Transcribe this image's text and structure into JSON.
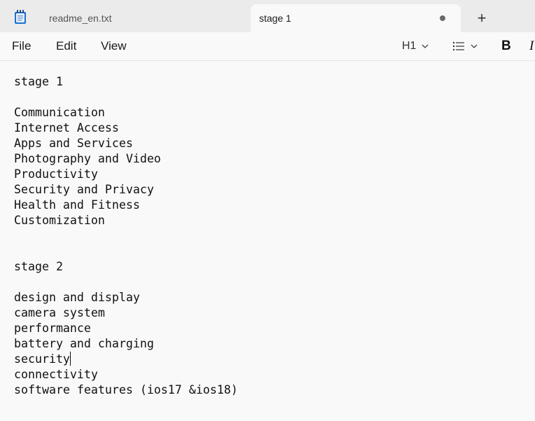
{
  "tabs": [
    {
      "label": "readme_en.txt",
      "active": false
    },
    {
      "label": "stage 1",
      "active": true,
      "unsaved": true
    }
  ],
  "new_tab_label": "+",
  "menu": {
    "file": "File",
    "edit": "Edit",
    "view": "View"
  },
  "toolbar": {
    "heading": "H1",
    "bold": "B",
    "italic": "I"
  },
  "editor": {
    "lines": [
      "stage 1",
      "",
      "Communication",
      "Internet Access",
      "Apps and Services",
      "Photography and Video",
      "Productivity",
      "Security and Privacy",
      "Health and Fitness",
      "Customization",
      "",
      "",
      "stage 2",
      "",
      "design and display",
      "camera system",
      "performance",
      "battery and charging",
      "security",
      "connectivity",
      "software features (ios17 &ios18)"
    ],
    "caret_line": 18
  },
  "colors": {
    "tabstrip_bg": "#ebebeb",
    "editor_bg": "#f9f9f9",
    "app_icon": "#1c6fd1"
  }
}
